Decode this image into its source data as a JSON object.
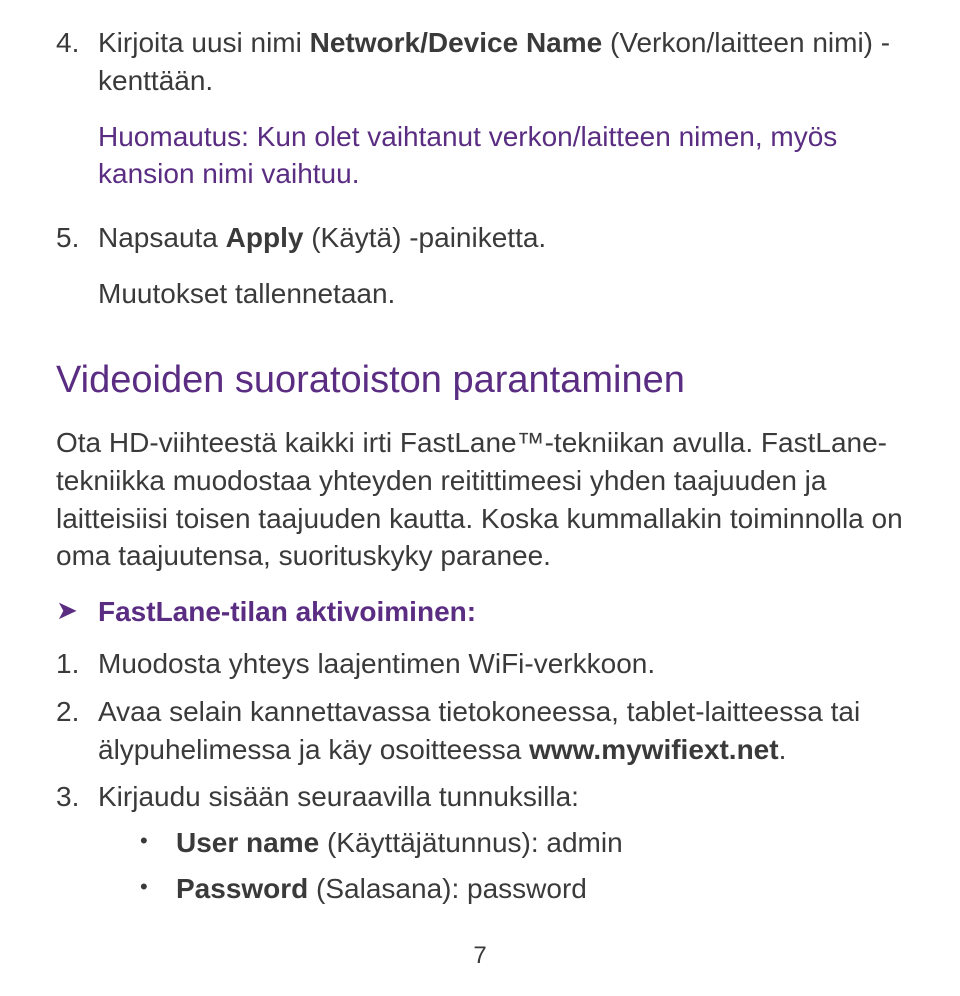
{
  "colors": {
    "purple": "#5a2d82",
    "body": "#3a3a3a"
  },
  "top_list": {
    "item4": {
      "num": "4.",
      "run1": "Kirjoita uusi nimi ",
      "bold1": "Network/Device Name",
      "run2": " (Verkon/laitteen nimi) -kenttään.",
      "note": "Huomautus: Kun olet vaihtanut verkon/laitteen nimen, myös kansion nimi vaihtuu."
    },
    "item5": {
      "num": "5.",
      "run1": "Napsauta ",
      "bold1": "Apply",
      "run2": " (Käytä) -painiketta.",
      "sub": "Muutokset tallennetaan."
    }
  },
  "heading": "Videoiden suoratoiston parantaminen",
  "para1": "Ota HD-viihteestä kaikki irti FastLane™-tekniikan avulla. FastLane-tekniikka muodostaa yhteyden reitittimeesi yhden taajuuden ja laitteisiisi toisen taajuuden kautta. Koska kummallakin toiminnolla on oma taajuutensa, suorituskyky paranee.",
  "fastlane_arrow": "➤",
  "fastlane_heading": "FastLane-tilan aktivoiminen:",
  "steps": {
    "s1": {
      "num": "1.",
      "text": "Muodosta yhteys laajentimen WiFi-verkkoon."
    },
    "s2": {
      "num": "2.",
      "run1": "Avaa selain kannettavassa tietokoneessa, tablet-laitteessa tai älypuhelimessa ja käy osoitteessa ",
      "bold1": "www.mywifiext.net",
      "run2": "."
    },
    "s3": {
      "num": "3.",
      "text": "Kirjaudu sisään seuraavilla tunnuksilla:",
      "sub1": {
        "dot": "•",
        "bold": "User name",
        "rest": " (Käyttäjätunnus): admin"
      },
      "sub2": {
        "dot": "•",
        "bold": "Password",
        "rest": " (Salasana): password"
      }
    }
  },
  "page_number": "7"
}
